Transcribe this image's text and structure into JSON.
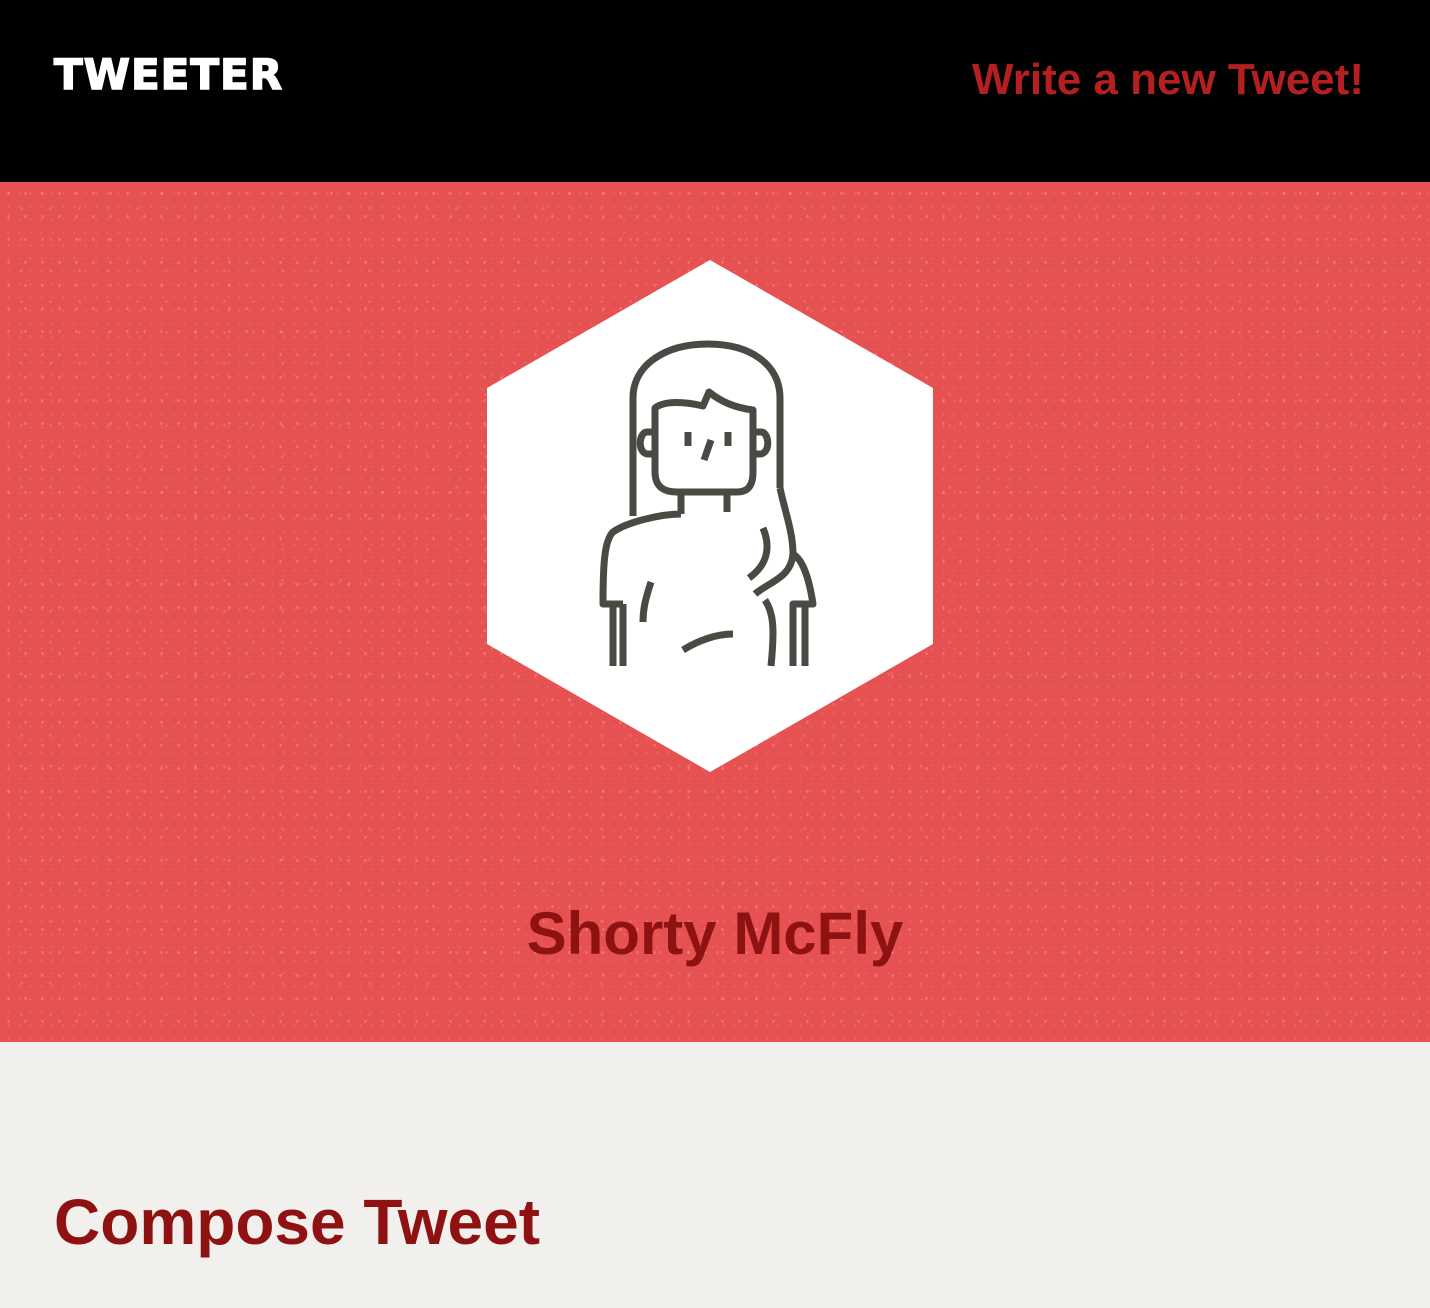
{
  "header": {
    "brand": "TWEETER",
    "write_link": "Write a new Tweet!"
  },
  "profile": {
    "name": "Shorty McFly",
    "avatar_icon": "person-avatar-icon"
  },
  "main": {
    "heading": "Compose Tweet"
  },
  "colors": {
    "header_bg": "#000000",
    "brand_text": "#ffffff",
    "accent_link": "#b3201f",
    "hero_bg": "#e65151",
    "name_text": "#8e1212",
    "page_bg": "#f1f0ec",
    "avatar_line": "#4a4a45"
  }
}
